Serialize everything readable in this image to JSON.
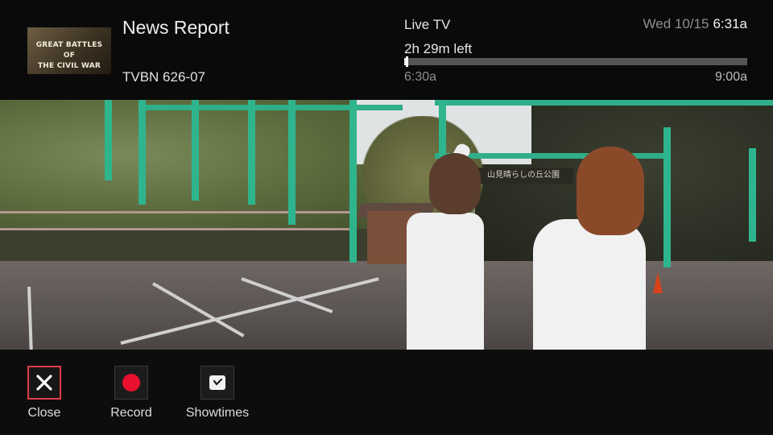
{
  "program": {
    "thumbnail_text": "GREAT BATTLES OF\nTHE CIVIL WAR",
    "title": "News Report",
    "channel": "TVBN 626-07"
  },
  "live": {
    "label": "Live TV",
    "time_left": "2h 29m left",
    "start_time": "6:30a",
    "end_time": "9:00a",
    "progress_fraction": 0.007
  },
  "clock": {
    "date": "Wed 10/15",
    "time": "6:31a"
  },
  "video": {
    "sign_text": "山見晴らしの丘公園"
  },
  "controls": [
    {
      "label": "Close",
      "icon": "close-icon",
      "focused": true
    },
    {
      "label": "Record",
      "icon": "record-icon",
      "focused": false
    },
    {
      "label": "Showtimes",
      "icon": "clock-icon",
      "focused": false
    }
  ],
  "colors": {
    "focus": "#e03c4a",
    "record": "#e8102d",
    "progress_fill": "#e8e8e8",
    "progress_track": "#555555"
  }
}
